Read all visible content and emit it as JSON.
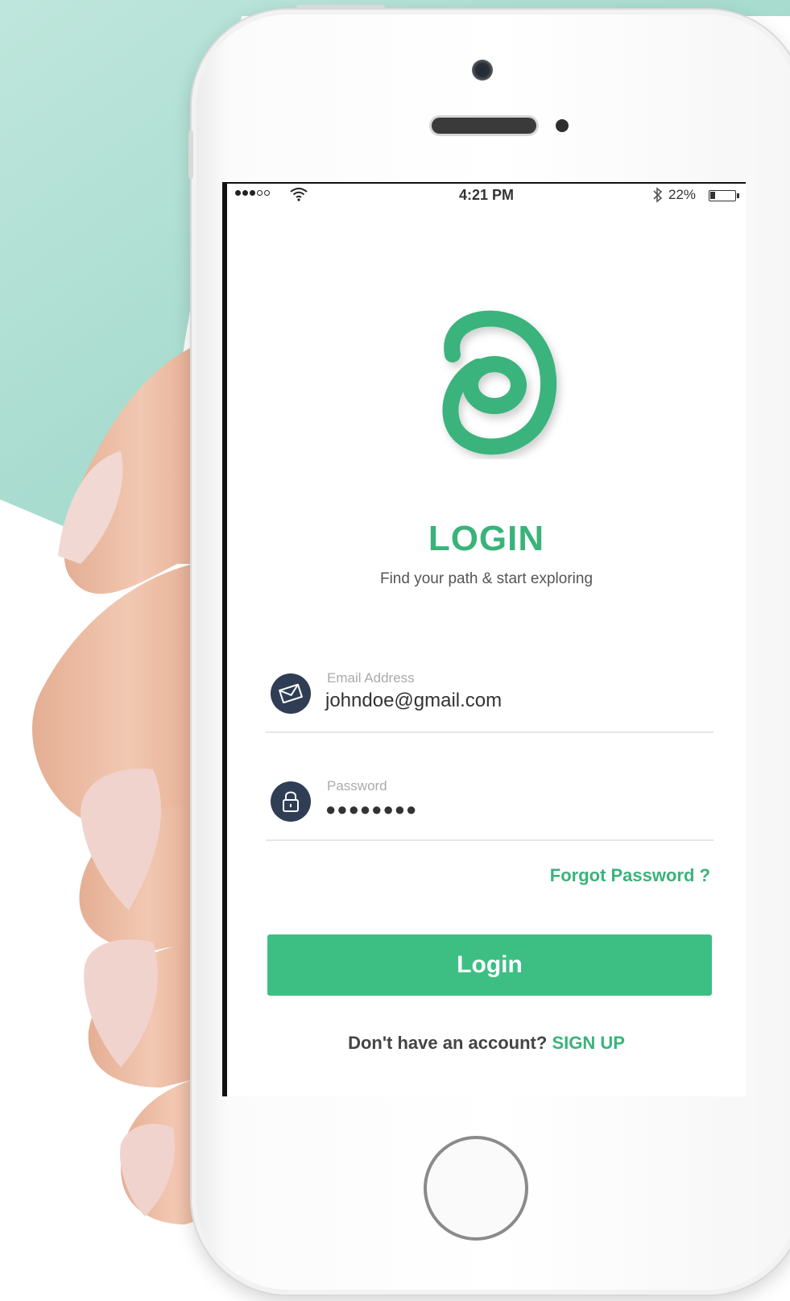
{
  "status_bar": {
    "time": "4:21 PM",
    "battery_percent": "22%",
    "battery_level": 0.22,
    "signal_bars_filled": 3,
    "signal_bars_total": 5
  },
  "app": {
    "title": "LOGIN",
    "subtitle": "Find your path & start exploring",
    "logo_icon": "app-logo-icon"
  },
  "email": {
    "label": "Email Address",
    "value": "johndoe@gmail.com",
    "icon": "envelope-icon"
  },
  "password": {
    "label": "Password",
    "value": "●●●●●●●●",
    "icon": "lock-icon"
  },
  "forgot_password": "Forgot Password ?",
  "login_button": "Login",
  "signup": {
    "prompt": "Don't have an account?",
    "link": "SIGN UP"
  },
  "colors": {
    "accent": "#3ab37b",
    "button": "#3dbf83",
    "icon_circle": "#2f3d55",
    "background_teal": "#a8dcd0"
  }
}
